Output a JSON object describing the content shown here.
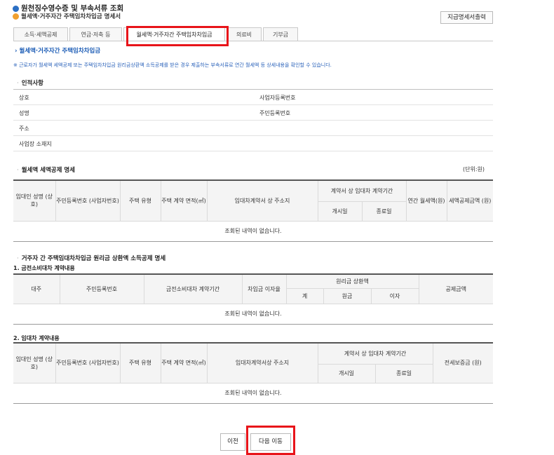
{
  "header": {
    "title": "원천징수영수증 및 부속서류 조회",
    "subtitle": "월세액·거주자간 주택임차차입금 명세서",
    "print_button": "지급명세서출력"
  },
  "tabs": [
    {
      "label": "소득·세액공제"
    },
    {
      "label": "연금·저축 등"
    },
    {
      "label": "월세액·거주자간 주택임차차입금"
    },
    {
      "label": "의료비"
    },
    {
      "label": "기부금"
    }
  ],
  "sub_title": "월세액·거주자간 주택임차차입금",
  "notice": "※ 근로자가 월세액 세액공제 또는 주택임차차입금 원리금상환액 소득공제를 받은 경우 제출하는 부속서류로 연간 월세액 등 상세내용을 확인할 수 있습니다.",
  "personal": {
    "title": "인적사항",
    "labels": {
      "company": "상호",
      "business_no": "사업자등록번호",
      "name": "성명",
      "resident_no": "주민등록번호",
      "address": "주소",
      "workplace": "사업장 소재지"
    }
  },
  "rent": {
    "title": "월세액 세액공제 명세",
    "unit": "(단위:원)",
    "headers": {
      "landlord": "임대인 성명 (상호)",
      "id_no": "주민등록번호 (사업자번호)",
      "house_type": "주택 유형",
      "area": "주택 계약 면적(㎡)",
      "address": "임대차계약서 상 주소지",
      "period": "계약서 상 임대차 계약기간",
      "start": "개시일",
      "end": "종료일",
      "annual_rent": "연간 월세액(원)",
      "deduction": "세액공제금액 (원)"
    },
    "empty": "조회된 내역이 없습니다."
  },
  "loan": {
    "title": "거주자 간 주택임대차차입금 원리금 상환액 소득공제 명세",
    "contract1": {
      "title": "1. 금전소비대차 계약내용",
      "headers": {
        "lender": "대주",
        "id_no": "주민등록번호",
        "period": "금전소비대차 계약기간",
        "rate": "차입금 이자율",
        "repay": "원리금 상환액",
        "total": "계",
        "principal": "원금",
        "interest": "이자",
        "deduction": "공제금액"
      },
      "empty": "조회된 내역이 없습니다."
    },
    "contract2": {
      "title": "2. 임대차 계약내용",
      "headers": {
        "landlord": "임대인 성명 (상호)",
        "id_no": "주민등록번호 (사업자번호)",
        "house_type": "주택 유형",
        "area": "주택 계약 면적(㎡)",
        "address": "임대차계약서상 주소지",
        "period": "계약서 상 임대차 계약기간",
        "start": "개시일",
        "end": "종료일",
        "deposit": "전세보증금 (원)"
      },
      "empty": "조회된 내역이 없습니다."
    }
  },
  "buttons": {
    "prev": "이전",
    "next": "다음 이동"
  },
  "colors": {
    "highlight": "#e8141a",
    "accent_blue": "#2b6fc4",
    "accent_orange": "#f0a030"
  }
}
